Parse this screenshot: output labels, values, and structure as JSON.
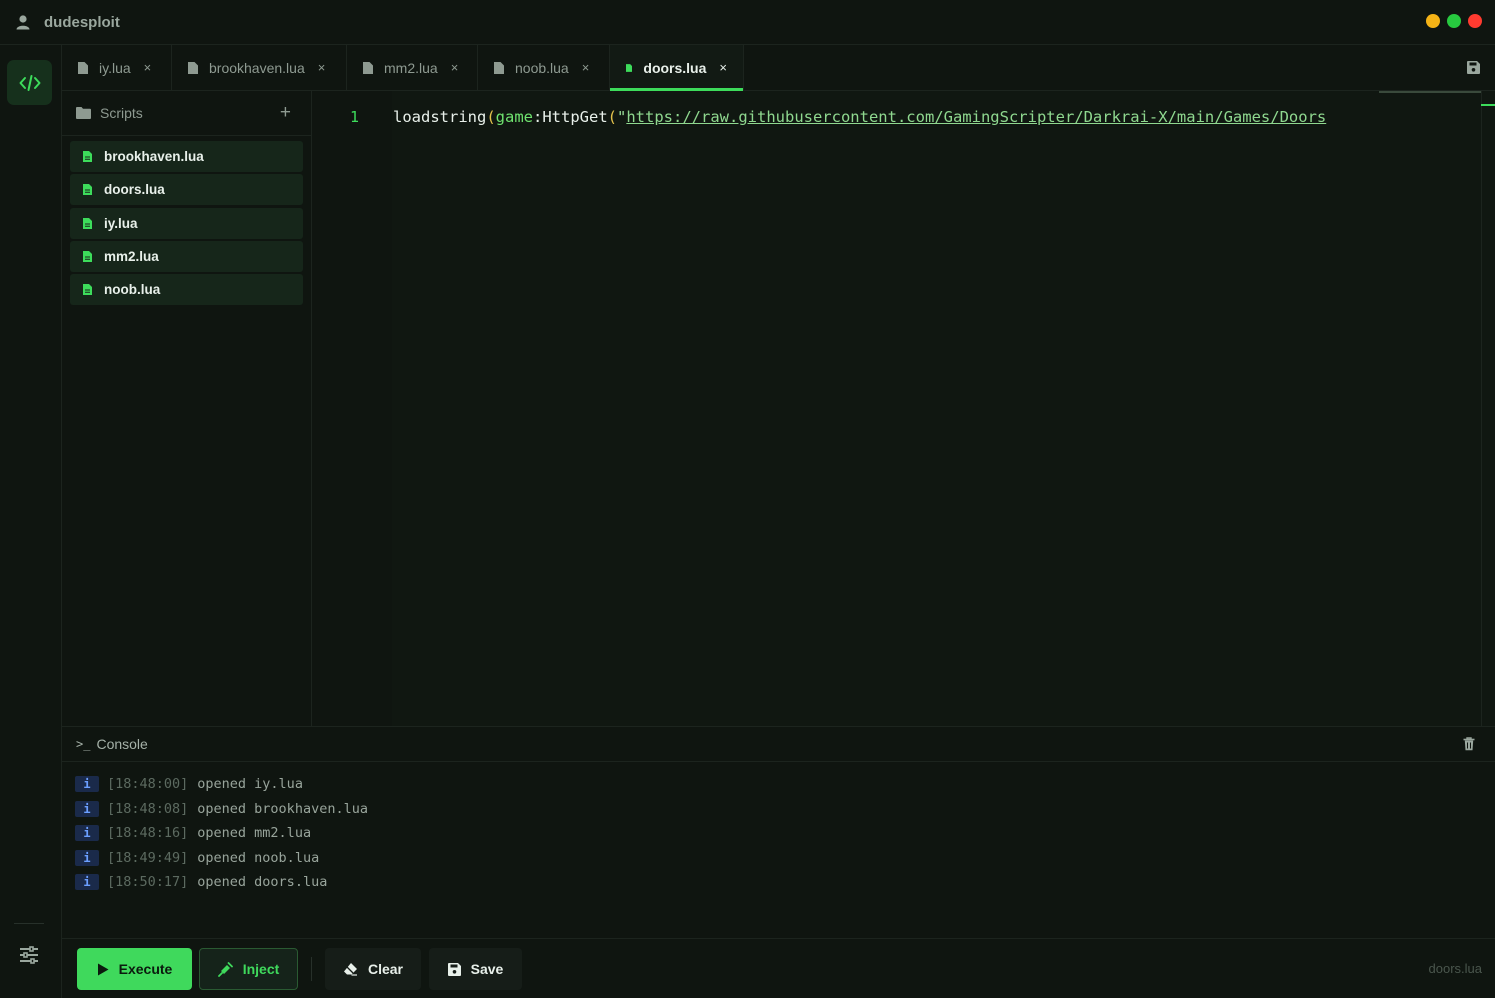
{
  "app": {
    "title": "dudesploit",
    "window_controls": [
      "minimize",
      "maximize",
      "close"
    ]
  },
  "colors": {
    "accent": "#3ddc5b",
    "minimize": "#f5b316",
    "maximize": "#27c93f",
    "close": "#ff3b30",
    "info_badge": "#6b9fff"
  },
  "tabs": [
    {
      "label": "iy.lua",
      "active": false
    },
    {
      "label": "brookhaven.lua",
      "active": false
    },
    {
      "label": "mm2.lua",
      "active": false
    },
    {
      "label": "noob.lua",
      "active": false
    },
    {
      "label": "doors.lua",
      "active": true
    }
  ],
  "tab_close_glyph": "×",
  "sidebar": {
    "title": "Scripts",
    "add_glyph": "+",
    "files": [
      "brookhaven.lua",
      "doors.lua",
      "iy.lua",
      "mm2.lua",
      "noob.lua"
    ]
  },
  "editor": {
    "line_number": "1",
    "tokens": {
      "fn": "loadstring",
      "open_paren": "(",
      "obj": "game",
      "method": ":HttpGet",
      "open_paren2": "(",
      "quote": "\"",
      "url": "https://raw.githubusercontent.com/GamingScripter/Darkrai-X/main/Games/Doors"
    }
  },
  "console": {
    "title": "Console",
    "prompt_glyph": ">_",
    "logs": [
      {
        "badge": "i",
        "time": "[18:48:00]",
        "message": "opened iy.lua"
      },
      {
        "badge": "i",
        "time": "[18:48:08]",
        "message": "opened brookhaven.lua"
      },
      {
        "badge": "i",
        "time": "[18:48:16]",
        "message": "opened mm2.lua"
      },
      {
        "badge": "i",
        "time": "[18:49:49]",
        "message": "opened noob.lua"
      },
      {
        "badge": "i",
        "time": "[18:50:17]",
        "message": "opened doors.lua"
      }
    ]
  },
  "actions": {
    "execute": "Execute",
    "inject": "Inject",
    "clear": "Clear",
    "save": "Save",
    "current_file": "doors.lua"
  },
  "icons": {
    "user": "user-icon",
    "code": "code-icon",
    "settings": "sliders-icon",
    "file": "file-icon",
    "folder": "folder-icon",
    "save": "floppy-icon",
    "trash": "trash-icon",
    "play": "play-icon",
    "syringe": "syringe-icon",
    "eraser": "eraser-icon"
  }
}
